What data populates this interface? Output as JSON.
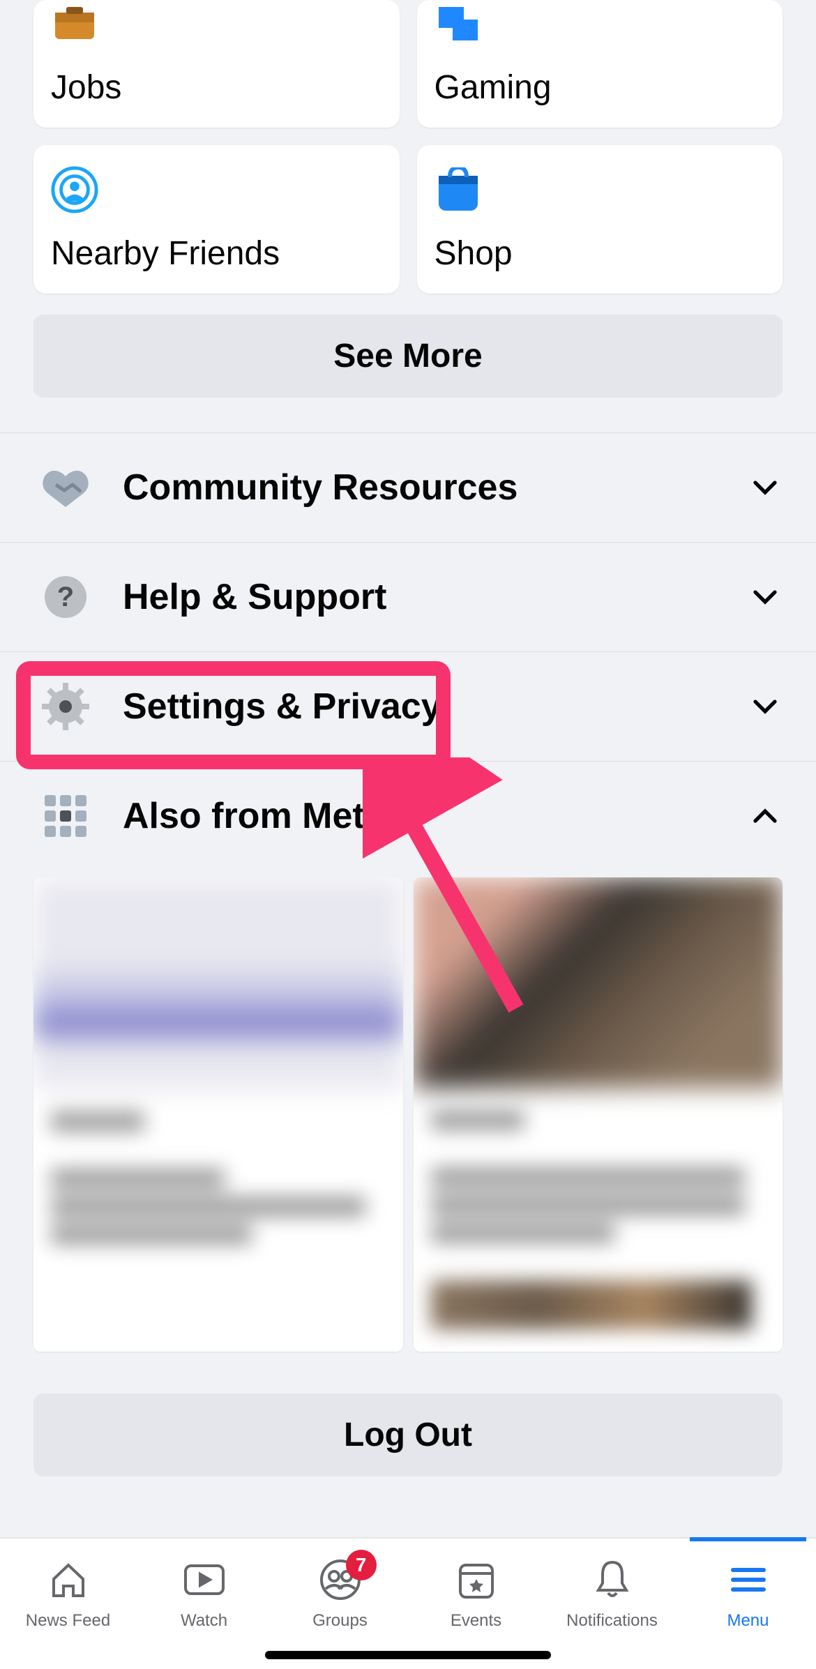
{
  "shortcut_cards": [
    {
      "icon": "jobs-icon",
      "label": "Jobs"
    },
    {
      "icon": "gaming-icon",
      "label": "Gaming"
    },
    {
      "icon": "nearby-friends-icon",
      "label": "Nearby Friends"
    },
    {
      "icon": "shop-icon",
      "label": "Shop"
    }
  ],
  "see_more_label": "See More",
  "menu_rows": [
    {
      "icon": "community-icon",
      "label": "Community Resources",
      "expanded": false
    },
    {
      "icon": "help-icon",
      "label": "Help & Support",
      "expanded": false
    },
    {
      "icon": "settings-icon",
      "label": "Settings & Privacy",
      "expanded": false,
      "highlighted": true
    },
    {
      "icon": "meta-grid-icon",
      "label": "Also from Meta",
      "expanded": true
    }
  ],
  "logout_label": "Log Out",
  "bottom_nav": {
    "items": [
      {
        "icon": "home-icon",
        "label": "News Feed",
        "active": false
      },
      {
        "icon": "watch-icon",
        "label": "Watch",
        "active": false
      },
      {
        "icon": "groups-icon",
        "label": "Groups",
        "active": false,
        "badge": "7"
      },
      {
        "icon": "events-icon",
        "label": "Events",
        "active": false
      },
      {
        "icon": "notifications-icon",
        "label": "Notifications",
        "active": false
      },
      {
        "icon": "menu-icon",
        "label": "Menu",
        "active": true
      }
    ]
  },
  "annotation": {
    "highlighted_item": "Settings & Privacy",
    "arrow_color": "#f7336d"
  }
}
